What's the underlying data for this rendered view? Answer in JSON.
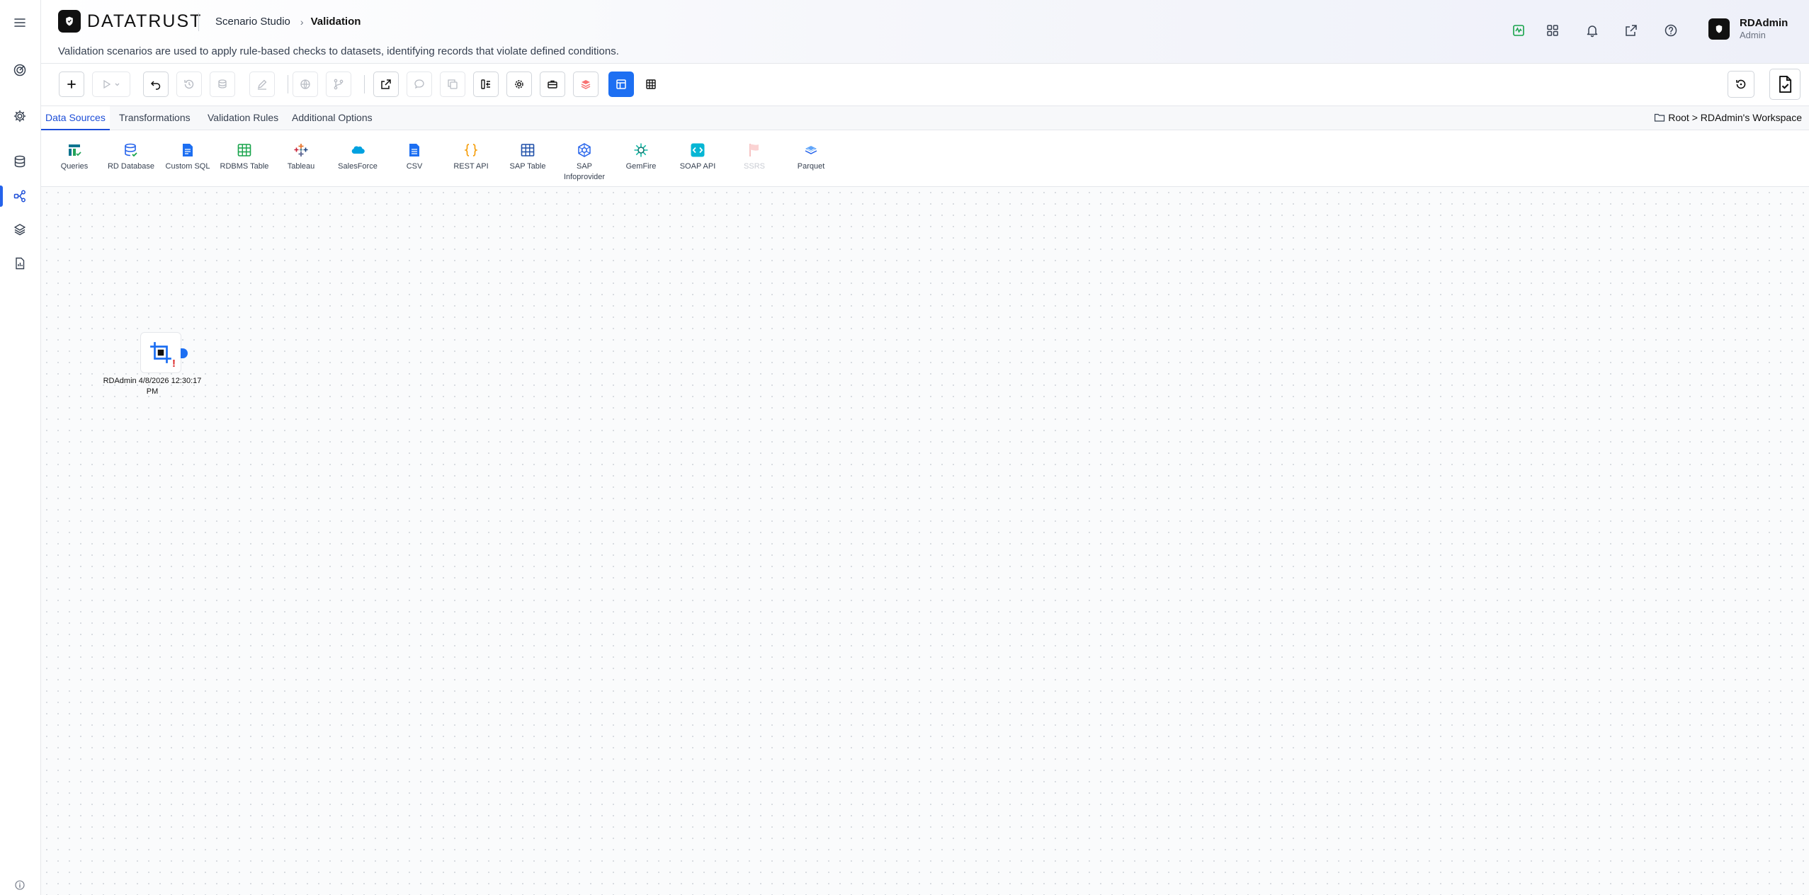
{
  "app": {
    "logo_text_a": "DATA",
    "logo_text_b": "TRUST"
  },
  "breadcrumb": {
    "parent": "Scenario Studio",
    "current": "Validation"
  },
  "header": {
    "description": "Validation scenarios are used to apply rule-based checks to datasets, identifying records that violate defined conditions."
  },
  "user": {
    "name": "RDAdmin",
    "role": "Admin"
  },
  "tabs": [
    {
      "label": "Data Sources",
      "active": true
    },
    {
      "label": "Transformations",
      "active": false
    },
    {
      "label": "Validation Rules",
      "active": false
    },
    {
      "label": "Additional Options",
      "active": false
    }
  ],
  "workspace_path": "Root > RDAdmin's Workspace",
  "palette": [
    {
      "label": "Queries",
      "icon": "queries-icon"
    },
    {
      "label": "RD Database",
      "icon": "rd-database-icon"
    },
    {
      "label": "Custom SQL",
      "icon": "custom-sql-icon"
    },
    {
      "label": "RDBMS Table",
      "icon": "rdbms-table-icon"
    },
    {
      "label": "Tableau",
      "icon": "tableau-icon"
    },
    {
      "label": "SalesForce",
      "icon": "salesforce-icon"
    },
    {
      "label": "CSV",
      "icon": "csv-icon"
    },
    {
      "label": "REST API",
      "icon": "rest-api-icon"
    },
    {
      "label": "SAP Table",
      "icon": "sap-table-icon"
    },
    {
      "label": "SAP Infoprovider",
      "icon": "sap-infoprovider-icon"
    },
    {
      "label": "GemFire",
      "icon": "gemfire-icon"
    },
    {
      "label": "SOAP API",
      "icon": "soap-api-icon"
    },
    {
      "label": "SSRS",
      "icon": "ssrs-icon",
      "disabled": true
    },
    {
      "label": "Parquet",
      "icon": "parquet-icon"
    }
  ],
  "canvas": {
    "node_label": "RDAdmin 4/8/2026 12:30:17 PM",
    "node_warning": "!"
  },
  "colors": {
    "accent": "#1d6ff2",
    "warning": "#dc2626"
  }
}
